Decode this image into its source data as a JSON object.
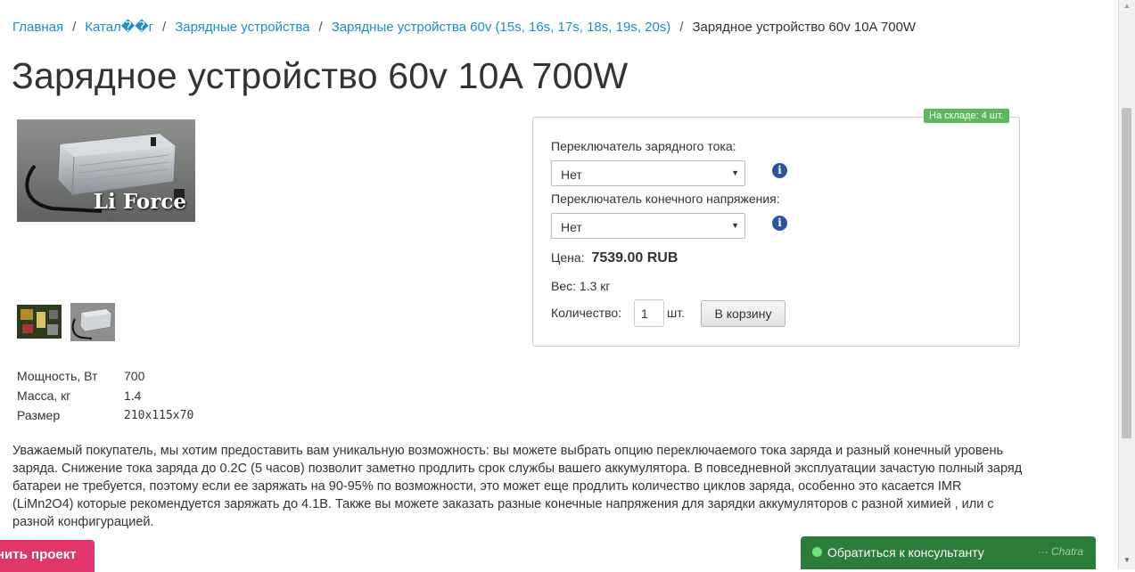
{
  "breadcrumb": {
    "items": [
      "Главная",
      "Катал��г",
      "Зарядные устройства",
      "Зарядные устройства 60v (15s, 16s, 17s, 18s, 19s, 20s)"
    ],
    "separator": "/",
    "current": "Зарядное устройство 60v 10A 700W"
  },
  "product": {
    "title": "Зарядное устройство 60v 10A 700W",
    "photo_watermark": "Li Force"
  },
  "order": {
    "stock_badge": "На складе: 4 шт.",
    "option1_label": "Переключатель зарядного тока:",
    "option1_value": "Нет",
    "option2_label": "Переключатель конечного напряжения:",
    "option2_value": "Нет",
    "info_glyph": "i",
    "price_label": "Цена:",
    "price_value": "7539.00 RUB",
    "weight_text": "Вес: 1.3 кг",
    "quantity_label": "Количество:",
    "quantity_value": "1",
    "quantity_unit": "шт.",
    "cart_button": "В корзину"
  },
  "specs": [
    {
      "key": "Мощность, Вт",
      "value": "700"
    },
    {
      "key": "Масса, кг",
      "value": "1.4"
    },
    {
      "key": "Размер",
      "value": "210x115x70"
    }
  ],
  "description": "Уважаемый покупатель, мы хотим предоставить вам уникальную возможность: вы можете выбрать опцию переключаемого тока заряда и разный конечный уровень заряда. Снижение тока заряда до 0.2С (5 часов) позволит заметно продлить срок службы вашего аккумулятора. В повседневной эксплуатации зачастую полный заряд батареи не требуется, поэтому если ее заряжать на 90-95% по возможности, это может еще продлить количество циклов заряда, особенно это касается IMR (LiMn2O4) которые рекомендуется заряжать до 4.1В. Также вы можете заказать разные конечные напряжения для зарядки аккумуляторов с разной химией , или с разной конфигурацией.",
  "widgets": {
    "project_button": "нить проект",
    "chat_text": "Обратиться к консультанту",
    "chat_brand": "··· Chatra"
  },
  "colors": {
    "link": "#1a8fc9",
    "stock_badge": "#5cb85c",
    "project_button": "#e0366c",
    "chat_widget": "#2d7d3a",
    "info_icon": "#2a53a0"
  }
}
